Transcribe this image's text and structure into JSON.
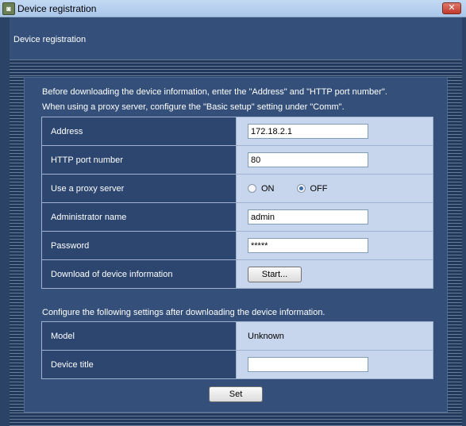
{
  "window": {
    "title": "Device registration",
    "icon": "camera-app-icon",
    "close_label": "✕"
  },
  "header": {
    "heading": "Device registration"
  },
  "intro": {
    "line1": "Before downloading the device information, enter the \"Address\" and \"HTTP port number\".",
    "line2": "When using a proxy server, configure the \"Basic setup\" setting under \"Comm\"."
  },
  "form": {
    "address_label": "Address",
    "address_value": "172.18.2.1",
    "port_label": "HTTP port number",
    "port_value": "80",
    "proxy_label": "Use a proxy server",
    "proxy_on_label": "ON",
    "proxy_off_label": "OFF",
    "proxy_selected": "OFF",
    "admin_label": "Administrator name",
    "admin_value": "admin",
    "password_label": "Password",
    "password_value": "*****",
    "download_label": "Download of device information",
    "start_button": "Start..."
  },
  "after": {
    "note": "Configure the following settings after downloading the device information.",
    "model_label": "Model",
    "model_value": "Unknown",
    "title_label": "Device title",
    "title_value": ""
  },
  "actions": {
    "set_button": "Set"
  },
  "colors": {
    "panel_bg": "#34507a",
    "value_cell_bg": "#c7d6ec",
    "label_cell_bg": "#2c4670"
  }
}
